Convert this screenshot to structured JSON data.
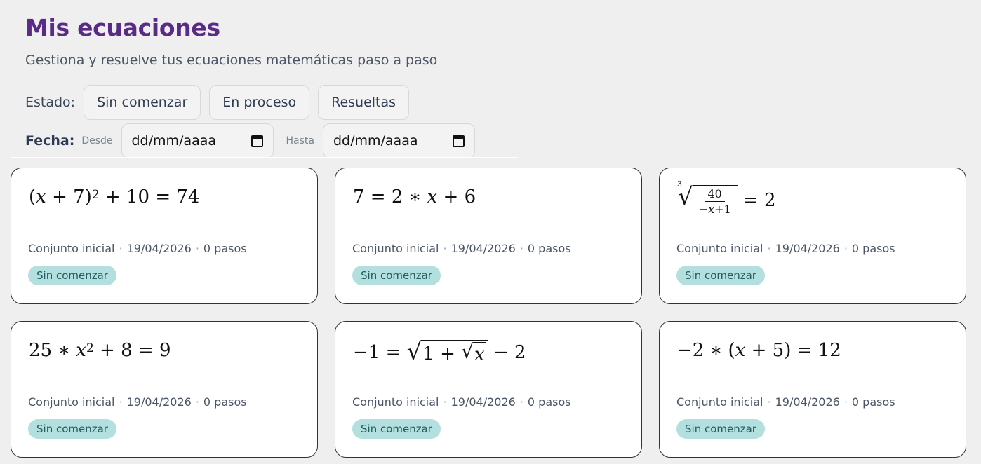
{
  "header": {
    "title": "Mis ecuaciones",
    "subtitle": "Gestiona y resuelve tus ecuaciones matemáticas paso a paso"
  },
  "filters": {
    "estado_label": "Estado:",
    "estado_options": [
      "Sin comenzar",
      "En proceso",
      "Resueltas"
    ],
    "fecha_label": "Fecha:",
    "desde_label": "Desde",
    "hasta_label": "Hasta",
    "desde_value": "dd/mm/aaaa",
    "hasta_value": "dd/mm/aaaa"
  },
  "cards": [
    {
      "equation": "(x + 7)² + 10 = 74",
      "set": "Conjunto inicial",
      "date": "19/04/2026",
      "steps": "0 pasos",
      "status": "Sin comenzar"
    },
    {
      "equation": "7 = 2 ∗ x + 6",
      "set": "Conjunto inicial",
      "date": "19/04/2026",
      "steps": "0 pasos",
      "status": "Sin comenzar"
    },
    {
      "equation": "∛(40 / (−x+1)) = 2",
      "set": "Conjunto inicial",
      "date": "19/04/2026",
      "steps": "0 pasos",
      "status": "Sin comenzar"
    },
    {
      "equation": "25 ∗ x² + 8 = 9",
      "set": "Conjunto inicial",
      "date": "19/04/2026",
      "steps": "0 pasos",
      "status": "Sin comenzar"
    },
    {
      "equation": "−1 = √(1 + √x) − 2",
      "set": "Conjunto inicial",
      "date": "19/04/2026",
      "steps": "0 pasos",
      "status": "Sin comenzar"
    },
    {
      "equation": "−2 ∗ (x + 5) = 12",
      "set": "Conjunto inicial",
      "date": "19/04/2026",
      "steps": "0 pasos",
      "status": "Sin comenzar"
    }
  ],
  "icons": {
    "date_picker": "calendar-icon"
  },
  "colors": {
    "title": "#5a2a87",
    "badge_bg": "#b4dfdf",
    "badge_text": "#1f5d5f",
    "card_border": "#2a3344"
  }
}
